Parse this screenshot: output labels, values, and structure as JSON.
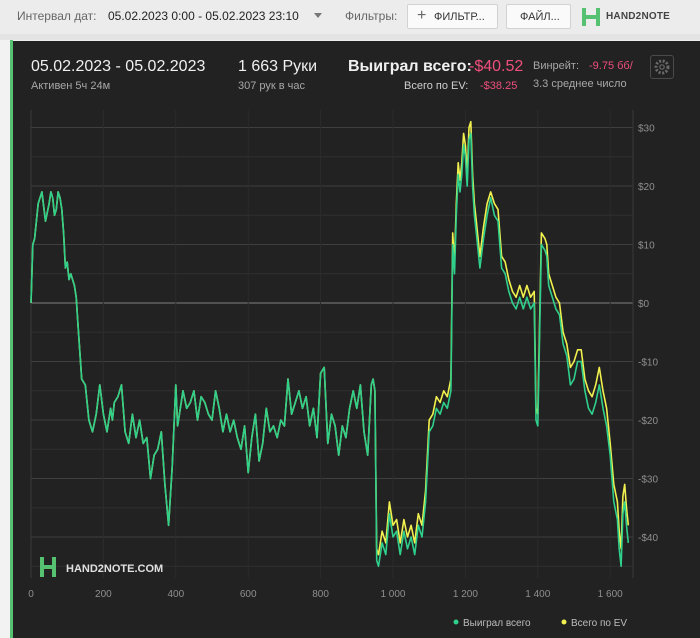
{
  "toolbar": {
    "interval_label": "Интервал дат:",
    "interval_value": "05.02.2023 0:00 - 05.02.2023 23:10",
    "filters_label": "Фильтры:",
    "filter_button": "ФИЛЬТР...",
    "file_button": "ФАЙЛ...",
    "logo_text": "HAND2NOTE"
  },
  "summary": {
    "date_range": "05.02.2023 - 05.02.2023",
    "active": "Активен 5ч 24м",
    "hands": "1 663 Руки",
    "hands_per_hour": "307 рук в час",
    "won_label": "Выиграл всего:",
    "won_value": "-$40.52",
    "ev_label": "Всего по EV:",
    "ev_value": "-$38.25",
    "winrate_label": "Винрейт:",
    "winrate_value": "-9.75 бб/",
    "avg_label": "3.3 среднее число"
  },
  "watermark": "HAND2NOTE.COM",
  "colors": {
    "won": "#2fcf8c",
    "ev": "#f1f04e",
    "panel": "#222222",
    "accent_red": "#ef4f7c",
    "brand_green": "#56c271"
  },
  "chart_data": {
    "type": "line",
    "x": [
      0,
      5,
      10,
      20,
      25,
      30,
      40,
      50,
      55,
      60,
      65,
      70,
      75,
      80,
      85,
      90,
      95,
      100,
      105,
      110,
      120,
      125,
      130,
      140,
      150,
      160,
      170,
      180,
      190,
      200,
      210,
      220,
      225,
      230,
      240,
      250,
      260,
      270,
      280,
      290,
      300,
      310,
      320,
      330,
      340,
      350,
      360,
      370,
      380,
      390,
      400,
      405,
      410,
      415,
      420,
      430,
      440,
      450,
      460,
      470,
      480,
      490,
      500,
      510,
      520,
      530,
      540,
      550,
      560,
      570,
      580,
      590,
      600,
      610,
      620,
      630,
      640,
      650,
      660,
      670,
      680,
      690,
      700,
      710,
      720,
      730,
      740,
      750,
      760,
      770,
      780,
      790,
      800,
      810,
      820,
      830,
      840,
      850,
      860,
      870,
      880,
      890,
      900,
      910,
      920,
      930,
      940,
      945,
      950,
      955,
      960,
      970,
      980,
      990,
      1000,
      1010,
      1020,
      1030,
      1040,
      1050,
      1060,
      1070,
      1080,
      1090,
      1100,
      1110,
      1120,
      1130,
      1140,
      1150,
      1160,
      1165,
      1170,
      1175,
      1180,
      1185,
      1190,
      1195,
      1200,
      1205,
      1210,
      1215,
      1220,
      1225,
      1230,
      1240,
      1250,
      1260,
      1270,
      1280,
      1290,
      1300,
      1310,
      1320,
      1330,
      1340,
      1350,
      1360,
      1370,
      1380,
      1390,
      1395,
      1400,
      1410,
      1420,
      1425,
      1430,
      1440,
      1450,
      1460,
      1470,
      1480,
      1490,
      1500,
      1510,
      1520,
      1530,
      1540,
      1550,
      1560,
      1570,
      1580,
      1590,
      1600,
      1610,
      1620,
      1625,
      1630,
      1635,
      1640,
      1645,
      1650,
      1655,
      1663
    ],
    "series": [
      {
        "name": "Выиграл всего",
        "values": [
          0,
          10,
          11,
          17,
          18,
          19,
          14,
          17,
          19,
          18,
          15,
          16,
          19,
          18,
          16,
          12,
          6,
          7,
          4,
          5,
          3,
          1,
          -4,
          -13,
          -14,
          -20,
          -22,
          -19,
          -14,
          -19,
          -22,
          -18,
          -20,
          -17,
          -16,
          -14,
          -22,
          -24,
          -19,
          -23,
          -20,
          -24,
          -23,
          -30,
          -26,
          -25,
          -22,
          -31,
          -38,
          -28,
          -14,
          -21,
          -19,
          -17,
          -15,
          -18,
          -17,
          -15,
          -20,
          -16,
          -17,
          -19,
          -20,
          -15,
          -18,
          -22,
          -19,
          -22,
          -20,
          -23,
          -25,
          -21,
          -29,
          -23,
          -19,
          -27,
          -24,
          -18,
          -22,
          -21,
          -23,
          -20,
          -21,
          -13,
          -19,
          -17,
          -15,
          -18,
          -16,
          -21,
          -18,
          -23,
          -12,
          -11,
          -24,
          -19,
          -21,
          -26,
          -21,
          -23,
          -18,
          -15,
          -18,
          -14,
          -22,
          -26,
          -14,
          -13,
          -15,
          -44,
          -45,
          -41,
          -43,
          -36,
          -40,
          -39,
          -43,
          -39,
          -42,
          -40,
          -43,
          -38,
          -40,
          -34,
          -22,
          -21,
          -18,
          -19,
          -17,
          -18,
          -15,
          10,
          5,
          15,
          22,
          19,
          22,
          27,
          25,
          20,
          28,
          29,
          20,
          15,
          12,
          6,
          11,
          15,
          18,
          15,
          14,
          6,
          5,
          2,
          0,
          -1,
          1,
          -1,
          1,
          -1,
          0,
          -20,
          -21,
          10,
          9,
          8,
          3,
          1,
          -1,
          -2,
          -7,
          -9,
          -14,
          -13,
          -10,
          -10,
          -15,
          -18,
          -19,
          -17,
          -14,
          -18,
          -21,
          -26,
          -34,
          -37,
          -42,
          -45,
          -36,
          -34,
          -38,
          -41
        ]
      },
      {
        "name": "Всего по EV",
        "values": [
          0,
          10,
          11,
          17,
          18,
          19,
          14,
          17,
          19,
          18,
          15,
          16,
          19,
          18,
          16,
          12,
          6,
          7,
          4,
          5,
          3,
          1,
          -4,
          -13,
          -14,
          -20,
          -22,
          -19,
          -14,
          -19,
          -22,
          -18,
          -20,
          -17,
          -16,
          -14,
          -22,
          -24,
          -19,
          -23,
          -20,
          -24,
          -23,
          -30,
          -26,
          -25,
          -22,
          -31,
          -38,
          -28,
          -14,
          -21,
          -19,
          -17,
          -15,
          -18,
          -17,
          -15,
          -20,
          -16,
          -17,
          -19,
          -20,
          -15,
          -18,
          -22,
          -19,
          -22,
          -20,
          -23,
          -25,
          -21,
          -29,
          -23,
          -19,
          -27,
          -24,
          -18,
          -22,
          -21,
          -23,
          -20,
          -21,
          -13,
          -19,
          -17,
          -15,
          -18,
          -16,
          -21,
          -18,
          -23,
          -12,
          -11,
          -24,
          -19,
          -21,
          -26,
          -21,
          -23,
          -18,
          -15,
          -18,
          -14,
          -22,
          -26,
          -14,
          -13,
          -15,
          -42,
          -43,
          -39,
          -41,
          -34,
          -38,
          -37,
          -41,
          -37,
          -40,
          -38,
          -41,
          -36,
          -38,
          -32,
          -20,
          -19,
          -16,
          -17,
          -15,
          -16,
          -13,
          12,
          7,
          17,
          24,
          21,
          24,
          29,
          27,
          22,
          30,
          31,
          22,
          17,
          14,
          8,
          13,
          17,
          19,
          17,
          16,
          8,
          7,
          4,
          2,
          1,
          3,
          1,
          3,
          1,
          2,
          -18,
          -19,
          12,
          11,
          10,
          5,
          3,
          1,
          0,
          -5,
          -7,
          -11,
          -10,
          -8,
          -8,
          -13,
          -15,
          -16,
          -14,
          -11,
          -15,
          -18,
          -24,
          -31,
          -34,
          -39,
          -42,
          -33,
          -31,
          -35,
          -38
        ]
      }
    ],
    "x_ticks": [
      "0",
      "200",
      "400",
      "600",
      "800",
      "1 000",
      "1 200",
      "1 400",
      "1 600"
    ],
    "y_ticks": [
      "$30",
      "$20",
      "$10",
      "$0",
      "-$10",
      "-$20",
      "-$30",
      "-$40"
    ],
    "xlim": [
      0,
      1663
    ],
    "ylim": [
      -47,
      33
    ],
    "grid": true,
    "legend_placement": "bottom-right"
  }
}
